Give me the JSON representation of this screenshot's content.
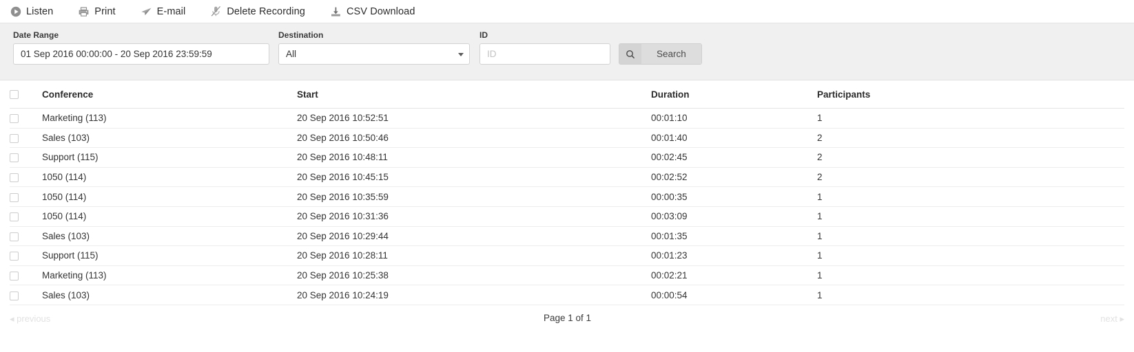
{
  "toolbar": {
    "actions": [
      {
        "label": "Listen",
        "icon": "play-circle-icon"
      },
      {
        "label": "Print",
        "icon": "printer-icon"
      },
      {
        "label": "E-mail",
        "icon": "paper-plane-icon"
      },
      {
        "label": "Delete Recording",
        "icon": "microphone-muted-icon"
      },
      {
        "label": "CSV Download",
        "icon": "download-tray-icon"
      }
    ]
  },
  "filters": {
    "date_range": {
      "label": "Date Range",
      "value": "01 Sep 2016 00:00:00 - 20 Sep 2016 23:59:59"
    },
    "destination": {
      "label": "Destination",
      "value": "All",
      "options": [
        "All"
      ],
      "caret_icon": "chevron-down-icon"
    },
    "id": {
      "label": "ID",
      "value": "",
      "placeholder": "ID"
    },
    "search": {
      "label": "Search",
      "icon": "search-icon"
    }
  },
  "table": {
    "columns": [
      "Conference",
      "Start",
      "Duration",
      "Participants"
    ],
    "rows": [
      {
        "conference": "Marketing (113)",
        "start": "20 Sep 2016 10:52:51",
        "duration": "00:01:10",
        "participants": "1"
      },
      {
        "conference": "Sales (103)",
        "start": "20 Sep 2016 10:50:46",
        "duration": "00:01:40",
        "participants": "2"
      },
      {
        "conference": "Support (115)",
        "start": "20 Sep 2016 10:48:11",
        "duration": "00:02:45",
        "participants": "2"
      },
      {
        "conference": "1050 (114)",
        "start": "20 Sep 2016 10:45:15",
        "duration": "00:02:52",
        "participants": "2"
      },
      {
        "conference": "1050 (114)",
        "start": "20 Sep 2016 10:35:59",
        "duration": "00:00:35",
        "participants": "1"
      },
      {
        "conference": "1050 (114)",
        "start": "20 Sep 2016 10:31:36",
        "duration": "00:03:09",
        "participants": "1"
      },
      {
        "conference": "Sales (103)",
        "start": "20 Sep 2016 10:29:44",
        "duration": "00:01:35",
        "participants": "1"
      },
      {
        "conference": "Support (115)",
        "start": "20 Sep 2016 10:28:11",
        "duration": "00:01:23",
        "participants": "1"
      },
      {
        "conference": "Marketing (113)",
        "start": "20 Sep 2016 10:25:38",
        "duration": "00:02:21",
        "participants": "1"
      },
      {
        "conference": "Sales (103)",
        "start": "20 Sep 2016 10:24:19",
        "duration": "00:00:54",
        "participants": "1"
      }
    ]
  },
  "pagination": {
    "previous": "◂ previous",
    "info": "Page 1 of 1",
    "next": "next ▸"
  },
  "colors": {
    "filter_bar_bg": "#f0f0f0",
    "search_button_bg": "#dddddd",
    "search_icon_bg": "#d4d4d4",
    "row_divider": "#ededed",
    "disabled_text": "#e2e2e2"
  }
}
